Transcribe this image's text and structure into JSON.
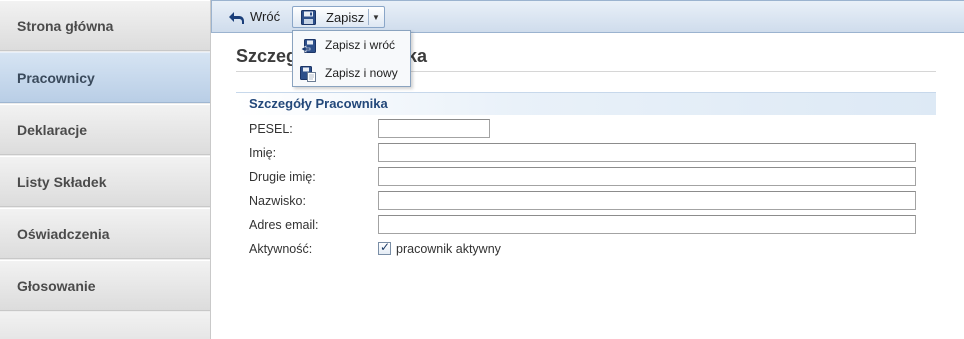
{
  "sidebar": {
    "items": [
      {
        "label": "Strona główna",
        "active": false
      },
      {
        "label": "Pracownicy",
        "active": true
      },
      {
        "label": "Deklaracje",
        "active": false
      },
      {
        "label": "Listy Składek",
        "active": false
      },
      {
        "label": "Oświadczenia",
        "active": false
      },
      {
        "label": "Głosowanie",
        "active": false
      }
    ]
  },
  "toolbar": {
    "back_label": "Wróć",
    "save_label": "Zapisz",
    "save_menu": [
      {
        "label": "Zapisz i wróć",
        "icon": "save-and-back-icon"
      },
      {
        "label": "Zapisz i nowy",
        "icon": "save-and-new-icon"
      }
    ]
  },
  "main": {
    "page_title": "Szczegóły pracownika",
    "section_title": "Szczegóły Pracownika",
    "fields": [
      {
        "label": "PESEL:",
        "value": "",
        "placeholder": ""
      },
      {
        "label": "Imię:",
        "value": "",
        "placeholder": ""
      },
      {
        "label": "Drugie imię:",
        "value": "",
        "placeholder": ""
      },
      {
        "label": "Nazwisko:",
        "value": "",
        "placeholder": ""
      },
      {
        "label": "Adres email:",
        "value": "",
        "placeholder": ""
      }
    ],
    "active_field": {
      "label": "Aktywność:",
      "checkbox_label": "pracownik aktywny",
      "checked": true
    }
  },
  "colors": {
    "accent": "#23487a",
    "active_nav": "#c8d9ed",
    "toolbar": "#dce6f2"
  }
}
